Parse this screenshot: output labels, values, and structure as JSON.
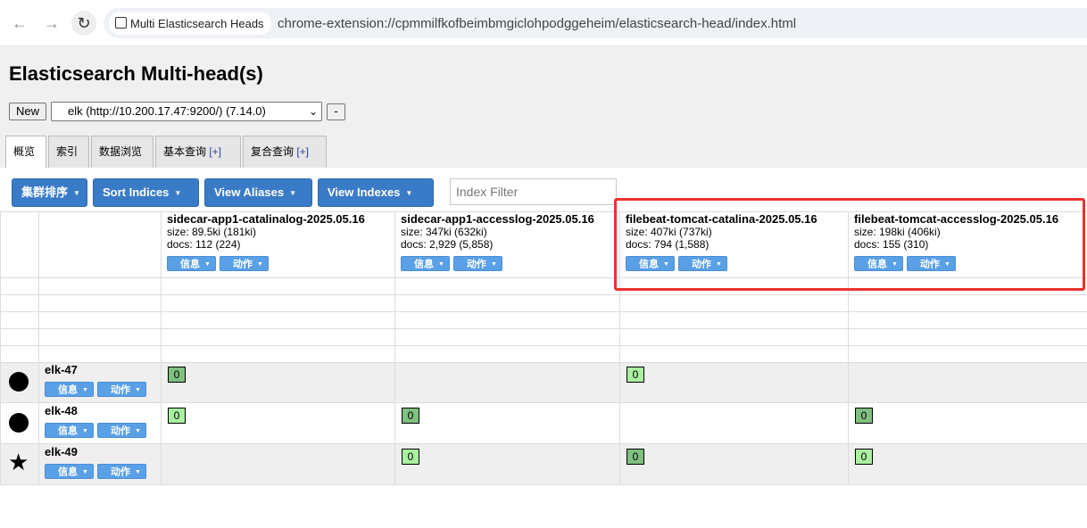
{
  "browser": {
    "tab_chip": "Multi Elasticsearch Heads",
    "url": "chrome-extension://cpmmilfkofbeimbmgiclohpodggeheim/elasticsearch-head/index.html"
  },
  "app": {
    "title": "Elasticsearch Multi-head(s)",
    "new_button": "New",
    "cluster_selected": "elk (http://10.200.17.47:9200/) (7.14.0)",
    "remove_button": "-"
  },
  "tabs": [
    {
      "label": "概览",
      "plus": ""
    },
    {
      "label": "索引",
      "plus": ""
    },
    {
      "label": "数据浏览",
      "plus": ""
    },
    {
      "label": "基本查询 ",
      "plus": "[+]"
    },
    {
      "label": "复合查询 ",
      "plus": "[+]"
    }
  ],
  "toolbar": {
    "cluster_sort": "集群排序",
    "sort_indices": "Sort Indices",
    "view_aliases": "View Aliases",
    "view_indexes": "View Indexes",
    "index_filter_placeholder": "Index Filter"
  },
  "buttons": {
    "info": "信息",
    "action": "动作"
  },
  "indices": [
    {
      "name": "sidecar-app1-catalinalog-2025.05.16",
      "size": "size: 89.5ki (181ki)",
      "docs": "docs: 112 (224)"
    },
    {
      "name": "sidecar-app1-accesslog-2025.05.16",
      "size": "size: 347ki (632ki)",
      "docs": "docs: 2,929 (5,858)"
    },
    {
      "name": "filebeat-tomcat-catalina-2025.05.16",
      "size": "size: 407ki (737ki)",
      "docs": "docs: 794 (1,588)"
    },
    {
      "name": "filebeat-tomcat-accesslog-2025.05.16",
      "size": "size: 198ki (406ki)",
      "docs": "docs: 155 (310)"
    }
  ],
  "nodes": [
    {
      "name": "elk-47",
      "icon": "circle-icon",
      "shards": [
        "0",
        "",
        "0",
        ""
      ]
    },
    {
      "name": "elk-48",
      "icon": "circle-icon",
      "shards": [
        "0",
        "0",
        "",
        "0"
      ]
    },
    {
      "name": "elk-49",
      "icon": "star-icon",
      "shards": [
        "",
        "0",
        "0",
        "0"
      ]
    }
  ],
  "colors": {
    "accent": "#3a7bc8",
    "small_button": "#5aa0e6",
    "shard_primary": "#80c080",
    "shard_replica": "#a9f0a0",
    "highlight": "#e8332f"
  }
}
